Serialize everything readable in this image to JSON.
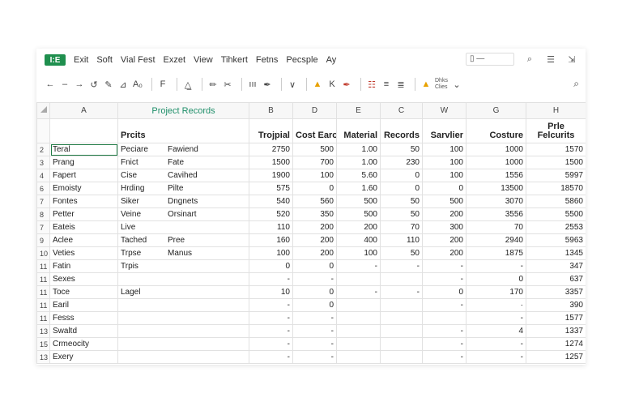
{
  "app": {
    "badge": "I:E"
  },
  "menu": [
    "Exit",
    "Soft",
    "Vial Fest",
    "Exzet",
    "View",
    "Tihkert",
    "Fetns",
    "Pecsple",
    "Ay"
  ],
  "window_controls": {
    "box_label": "▯ —",
    "search": "⌕",
    "grid": "☰",
    "close": "⇲"
  },
  "toolbar": {
    "items": [
      "←",
      "–",
      "→",
      "↺",
      "✎",
      "⊿",
      "A₀",
      "F",
      "△̲",
      "✏",
      "✂",
      "ııı",
      "✒",
      "∨",
      "▲",
      "K",
      "✒"
    ],
    "right_items": [
      "☷",
      "≡",
      "≣",
      "▲"
    ],
    "small_label_1": "Dhks",
    "small_label_2": "Clies",
    "search": "⌕"
  },
  "sheet": {
    "columns": [
      "A",
      "Project Records",
      "B",
      "D",
      "E",
      "C",
      "W",
      "G",
      "H"
    ],
    "header_row": [
      "",
      "Prcits",
      "Trojpial",
      "Cost Earol",
      "Material",
      "Records",
      "Sarvlier",
      "Costure",
      "Prle Felcurits"
    ],
    "rows": [
      {
        "num": "2",
        "a": "Teral",
        "b1": "Peciare",
        "b2": "Fawiend",
        "b": "2750",
        "d": "500",
        "e": "1.00",
        "c": "50",
        "w": "100",
        "g": "1000",
        "h": "1570"
      },
      {
        "num": "3",
        "a": "Prang",
        "b1": "Fnict",
        "b2": "Fate",
        "b": "1500",
        "d": "700",
        "e": "1.00",
        "c": "230",
        "w": "100",
        "g": "1000",
        "h": "1500"
      },
      {
        "num": "4",
        "a": "Fapert",
        "b1": "Cise",
        "b2": "Cavihed",
        "b": "1900",
        "d": "100",
        "e": "5.60",
        "c": "0",
        "w": "100",
        "g": "1556",
        "h": "5997"
      },
      {
        "num": "6",
        "a": "Emoisty",
        "b1": "Hrding",
        "b2": "Pilte",
        "b": "575",
        "d": "0",
        "e": "1.60",
        "c": "0",
        "w": "0",
        "g": "13500",
        "h": "18570"
      },
      {
        "num": "7",
        "a": "Fontes",
        "b1": "Siker",
        "b2": "Dngnets",
        "b": "540",
        "d": "560",
        "e": "500",
        "c": "50",
        "w": "500",
        "g": "3070",
        "h": "5860"
      },
      {
        "num": "8",
        "a": "Petter",
        "b1": "Veine",
        "b2": "Orsinart",
        "b": "520",
        "d": "350",
        "e": "500",
        "c": "50",
        "w": "200",
        "g": "3556",
        "h": "5500"
      },
      {
        "num": "7",
        "a": "Eateis",
        "b1": "Live",
        "b2": "",
        "b": "110",
        "d": "200",
        "e": "200",
        "c": "70",
        "w": "300",
        "g": "70",
        "h": "2553"
      },
      {
        "num": "9",
        "a": "Aclee",
        "b1": "Tached",
        "b2": "Pree",
        "b": "160",
        "d": "200",
        "e": "400",
        "c": "110",
        "w": "200",
        "g": "2940",
        "h": "5963"
      },
      {
        "num": "10",
        "a": "Veties",
        "b1": "Trpse",
        "b2": "Manus",
        "b": "100",
        "d": "200",
        "e": "100",
        "c": "50",
        "w": "200",
        "g": "1875",
        "h": "1345"
      },
      {
        "num": "11",
        "a": "Fatin",
        "b1": "Trpis",
        "b2": "",
        "b": "0",
        "d": "0",
        "e": "-",
        "c": "-",
        "w": "-",
        "g": "-",
        "h": "347"
      },
      {
        "num": "11",
        "a": "Sexes",
        "b1": "",
        "b2": "",
        "b": "-",
        "d": "-",
        "e": "",
        "c": "",
        "w": "-",
        "g": "0",
        "h": "637"
      },
      {
        "num": "11",
        "a": "Toce",
        "b1": "Lagel",
        "b2": "",
        "b": "10",
        "d": "0",
        "e": "-",
        "c": "-",
        "w": "0",
        "g": "170",
        "h": "3357"
      },
      {
        "num": "11",
        "a": "Earil",
        "b1": "",
        "b2": "",
        "b": "-",
        "d": "0",
        "e": "",
        "c": "",
        "w": "-",
        "g": "·",
        "h": "390"
      },
      {
        "num": "11",
        "a": "Fesss",
        "b1": "",
        "b2": "",
        "b": "-",
        "d": "-",
        "e": "",
        "c": "",
        "w": "",
        "g": "-",
        "h": "1577"
      },
      {
        "num": "13",
        "a": "Swaltd",
        "b1": "",
        "b2": "",
        "b": "-",
        "d": "-",
        "e": "",
        "c": "",
        "w": "-",
        "g": "4",
        "h": "1337"
      },
      {
        "num": "15",
        "a": "Crmeocity",
        "b1": "",
        "b2": "",
        "b": "-",
        "d": "-",
        "e": "",
        "c": "",
        "w": "-",
        "g": "-",
        "h": "1274"
      },
      {
        "num": "13",
        "a": "Exery",
        "b1": "",
        "b2": "",
        "b": "-",
        "d": "-",
        "e": "",
        "c": "",
        "w": "-",
        "g": "-",
        "h": "1257"
      }
    ]
  }
}
